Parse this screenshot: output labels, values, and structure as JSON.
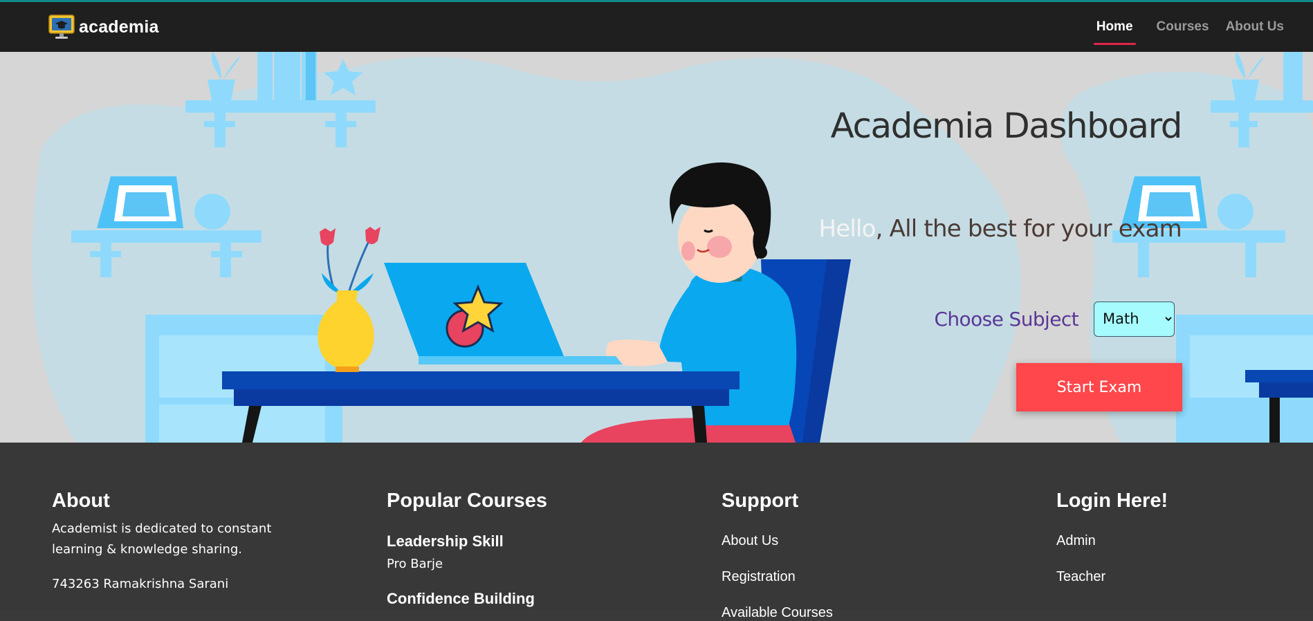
{
  "navbar": {
    "brand": "academia",
    "links": [
      {
        "label": "Home",
        "active": true
      },
      {
        "label": "Courses",
        "active": false
      },
      {
        "label": "About Us",
        "active": false
      }
    ],
    "accent_color": "#e3264a"
  },
  "hero": {
    "title": "Academia Dashboard",
    "greeting_highlight": "Hello",
    "greeting_rest": ", All the best for your exam",
    "choose_label": "Choose Subject",
    "subject": {
      "selected": "Math",
      "options": [
        "Math"
      ]
    },
    "start_button": "Start Exam",
    "button_color": "#ff474c"
  },
  "footer": {
    "about": {
      "heading": "About",
      "text": "Academist is dedicated to constant learning & knowledge sharing.",
      "address": "743263 Ramakrishna Sarani"
    },
    "courses": {
      "heading": "Popular Courses",
      "items": [
        {
          "name": "Leadership Skill",
          "author": "Pro Barje"
        },
        {
          "name": "Confidence Building",
          "author": ""
        }
      ]
    },
    "support": {
      "heading": "Support",
      "links": [
        "About Us",
        "Registration",
        "Available Courses"
      ]
    },
    "login": {
      "heading": "Login Here!",
      "links": [
        "Admin",
        "Teacher"
      ]
    }
  }
}
